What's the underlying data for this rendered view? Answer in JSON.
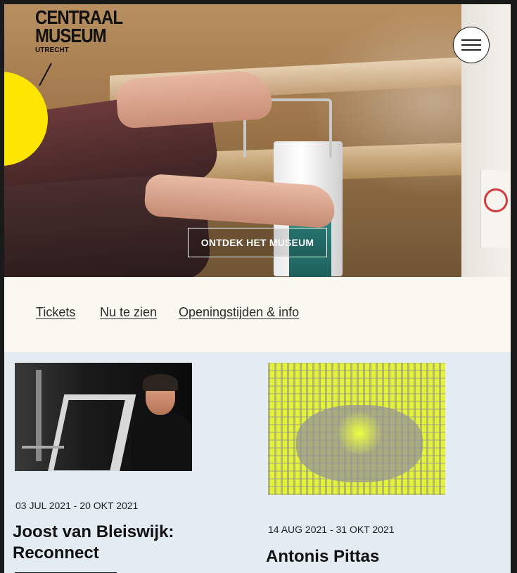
{
  "header": {
    "logo": {
      "line1": "CENTRAAL",
      "line2": "MUSEUM",
      "line3": "UTRECHT"
    },
    "menu_icon": "hamburger-icon",
    "cta_label": "ONTDEK HET MUSEUM"
  },
  "quicknav": {
    "links": [
      "Tickets",
      "Nu te zien",
      "Openingstijden & info"
    ]
  },
  "exhibitions": [
    {
      "dates": "03 JUL 2021 - 20 OKT 2021",
      "title_line1": "Joost van Bleiswijk:",
      "title_line2": "Reconnect"
    },
    {
      "dates": "14 AUG 2021 - 31 OKT 2021",
      "title": "Antonis Pittas"
    }
  ],
  "colors": {
    "accent_yellow": "#ffe600",
    "quicknav_bg": "#fbf8f1",
    "exhibits_bg": "#e3ebf3"
  }
}
